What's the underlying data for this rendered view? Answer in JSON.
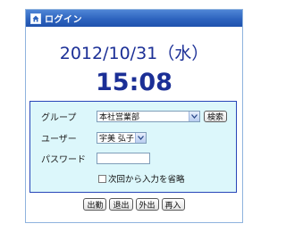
{
  "window": {
    "title": "ログイン",
    "icon": "home-icon"
  },
  "datetime": {
    "date": "2012/10/31（水）",
    "time": "15:08"
  },
  "form": {
    "group": {
      "label": "グループ",
      "selected": "本社営業部",
      "search_button": "検索"
    },
    "user": {
      "label": "ユーザー",
      "selected": "宇美 弘子"
    },
    "password": {
      "label": "パスワード",
      "value": ""
    },
    "remember": {
      "label": "次回から入力を省略",
      "checked": false
    }
  },
  "actions": {
    "checkin": "出勤",
    "checkout": "退出",
    "goout": "外出",
    "reenter": "再入"
  },
  "colors": {
    "titlebar": "#2d63be",
    "text_blue": "#1b2f96",
    "panel_bg": "#dcf7fb",
    "panel_border": "#2846b8"
  }
}
